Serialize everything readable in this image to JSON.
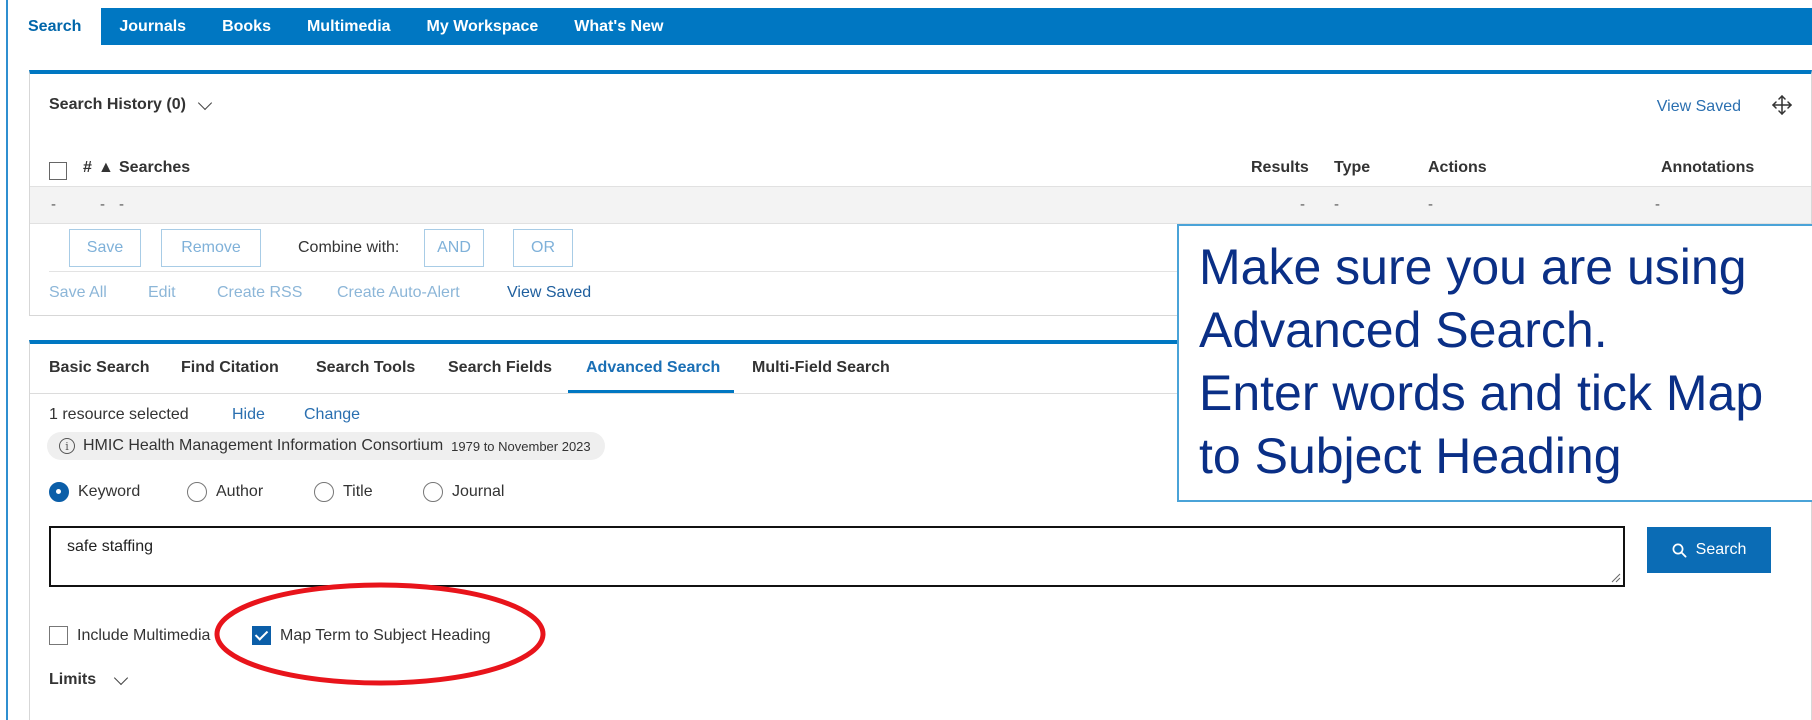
{
  "top_nav": {
    "tabs": [
      {
        "label": "Search",
        "active": true
      },
      {
        "label": "Journals",
        "active": false
      },
      {
        "label": "Books",
        "active": false
      },
      {
        "label": "Multimedia",
        "active": false
      },
      {
        "label": "My Workspace",
        "active": false
      },
      {
        "label": "What's New",
        "active": false
      }
    ]
  },
  "search_history": {
    "title": "Search History (0)",
    "view_saved": "View Saved",
    "columns": {
      "number": "#",
      "sort_indicator": "▲",
      "searches": "Searches",
      "results": "Results",
      "type": "Type",
      "actions": "Actions",
      "annotations": "Annotations"
    },
    "empty_row": {
      "number": "-",
      "searches_a": "-",
      "searches_b": "-",
      "results": "-",
      "type": "-",
      "actions": "-",
      "annotations": "-"
    },
    "buttons": {
      "save": "Save",
      "remove": "Remove",
      "combine_with": "Combine with:",
      "and": "AND",
      "or": "OR"
    },
    "links": {
      "save_all": "Save All",
      "edit": "Edit",
      "create_rss": "Create RSS",
      "create_auto_alert": "Create Auto-Alert",
      "view_saved": "View Saved"
    }
  },
  "search_panel": {
    "tabs": [
      {
        "label": "Basic Search",
        "active": false
      },
      {
        "label": "Find Citation",
        "active": false
      },
      {
        "label": "Search Tools",
        "active": false
      },
      {
        "label": "Search Fields",
        "active": false
      },
      {
        "label": "Advanced Search",
        "active": true
      },
      {
        "label": "Multi-Field Search",
        "active": false
      }
    ],
    "resource_selected": "1 resource selected",
    "hide": "Hide",
    "change": "Change",
    "resource": {
      "info_icon": "ⓘ",
      "name": "HMIC Health Management Information Consortium",
      "years": "1979 to November 2023"
    },
    "search_types": [
      {
        "label": "Keyword",
        "selected": true
      },
      {
        "label": "Author",
        "selected": false
      },
      {
        "label": "Title",
        "selected": false
      },
      {
        "label": "Journal",
        "selected": false
      }
    ],
    "query": "safe staffing",
    "search_button": "Search",
    "options": {
      "include_multimedia": {
        "label": "Include Multimedia",
        "checked": false
      },
      "map_term": {
        "label": "Map Term to Subject Heading",
        "checked": true
      }
    },
    "limits": "Limits"
  },
  "annotation": {
    "lines": [
      "Make sure you are using",
      "Advanced Search.",
      "Enter words and tick Map",
      "to Subject Heading"
    ],
    "highlight_color": "#e8141b",
    "text_color": "#0a2f86"
  },
  "colors": {
    "brand_blue": "#0077c2",
    "link_blue": "#2a6fb0",
    "muted_link": "#8cb6d8"
  }
}
